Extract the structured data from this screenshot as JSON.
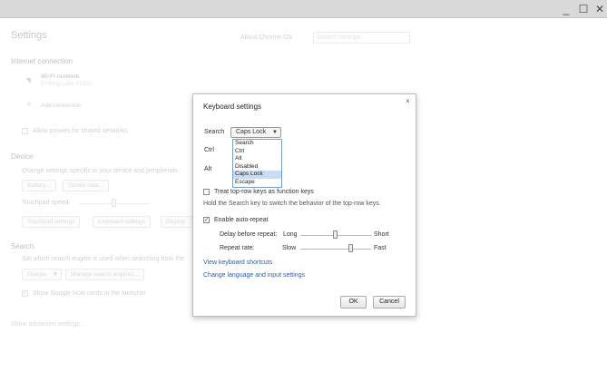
{
  "window": {
    "minimize": "_",
    "maximize": "☐",
    "close": "✕"
  },
  "page": {
    "title": "Settings",
    "about_link": "About Chrome OS",
    "search_placeholder": "Search settings",
    "internet": {
      "heading": "Internet connection",
      "wifi_label": "Wi-Fi network",
      "wifi_name": "PYMng Labs FODC",
      "add_connection": "Add connection",
      "proxies": "Allow proxies for shared networks"
    },
    "device": {
      "heading": "Device",
      "desc": "Change settings specific to your device and peripherals.",
      "battery": "Battery...",
      "stored_data": "Stored data...",
      "touchpad_speed": "Touchpad speed:",
      "touchpad_settings": "Touchpad settings",
      "keyboard_settings": "Keyboard settings",
      "display_settings": "Display s"
    },
    "search": {
      "heading": "Search",
      "desc": "Set which search engine is used when searching from the",
      "engine": "Google",
      "manage": "Manage search engines...",
      "google_now": "Show Google Now cards in the launcher"
    },
    "advanced": "Show advanced settings..."
  },
  "dialog": {
    "title": "Keyboard settings",
    "close": "×",
    "search_label": "Search",
    "search_value": "Caps Lock",
    "dropdown_options": [
      "Search",
      "Ctrl",
      "Alt",
      "Disabled",
      "Caps Lock",
      "Escape"
    ],
    "selected_option": "Caps Lock",
    "ctrl_label": "Ctrl",
    "alt_label": "Alt",
    "toprow_label": "Treat top-row keys as function keys",
    "toprow_checked": false,
    "hint": "Hold the Search key to switch the behavior of the top-row keys.",
    "autorepeat_label": "Enable auto-repeat",
    "autorepeat_checked": true,
    "delay_label": "Delay before repeat:",
    "delay_low": "Long",
    "delay_high": "Short",
    "delay_value": 0.5,
    "rate_label": "Repeat rate:",
    "rate_low": "Slow",
    "rate_high": "Fast",
    "rate_value": 0.72,
    "shortcuts_link": "View keyboard shortcuts",
    "language_link": "Change language and input settings",
    "ok": "OK",
    "cancel": "Cancel"
  },
  "colors": {
    "link": "#2a5db0",
    "selection": "#c9dcf3"
  }
}
